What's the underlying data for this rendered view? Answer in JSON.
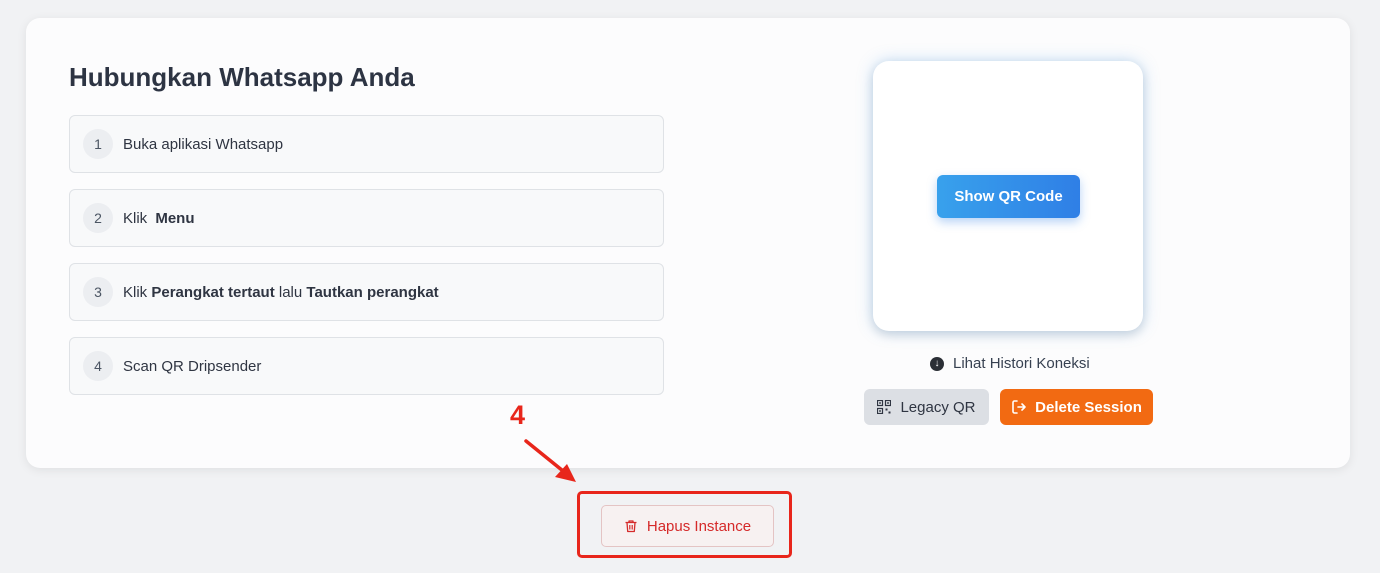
{
  "header": {
    "title": "Hubungkan Whatsapp Anda"
  },
  "steps": [
    {
      "num": "1",
      "text": "Buka aplikasi Whatsapp"
    },
    {
      "num": "2",
      "pre": "Klik ",
      "bold1": "Menu"
    },
    {
      "num": "3",
      "pre": "Klik ",
      "bold1": "Perangkat tertaut",
      "mid": " lalu ",
      "bold2": "Tautkan perangkat"
    },
    {
      "num": "4",
      "text": "Scan QR Dripsender"
    }
  ],
  "qr": {
    "show_label": "Show QR Code"
  },
  "history": {
    "label": "Lihat Histori Koneksi"
  },
  "actions": {
    "legacy_label": "Legacy QR",
    "delete_label": "Delete Session"
  },
  "annotation": {
    "number": "4"
  },
  "footer": {
    "hapus_label": "Hapus Instance"
  },
  "colors": {
    "accent_blue": "#2f7fe6",
    "delete_orange": "#f26a12",
    "danger_red": "#d52a2a",
    "annotation_red": "#e8261b"
  }
}
